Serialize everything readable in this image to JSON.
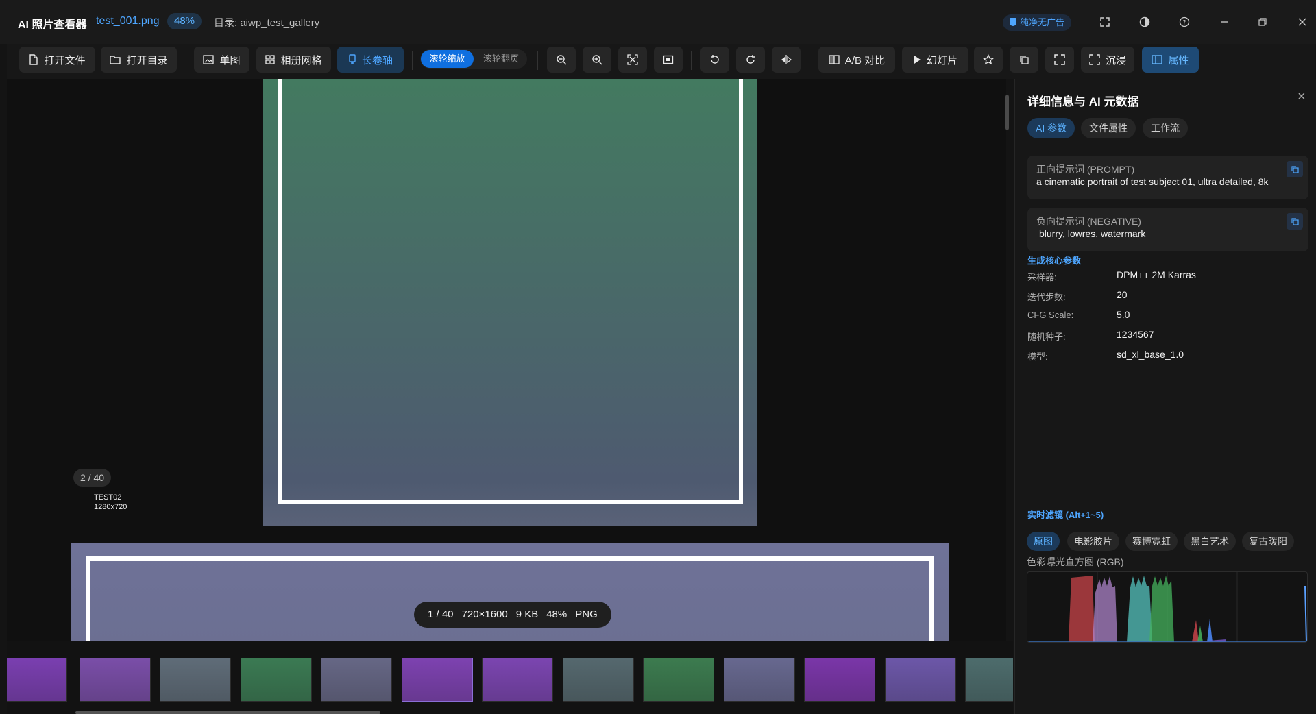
{
  "app": {
    "title": "AI 照片查看器",
    "file_name": "test_001.png",
    "zoom": "48%",
    "directory": "目录: aiwp_test_gallery",
    "no_ads": "纯净无广告",
    "accent_color": "#4ea6ff"
  },
  "toolbar": {
    "open_file": "打开文件",
    "open_dir": "打开目录",
    "single": "单图",
    "grid": "相册网格",
    "scroll": "长卷轴",
    "wheel_zoom": "滚轮缩放",
    "wheel_page": "滚轮翻页",
    "ab_compare": "A/B 对比",
    "slideshow": "幻灯片",
    "immersive": "沉浸",
    "properties": "属性"
  },
  "viewer": {
    "image2_badge": "2 / 40",
    "image2_label_line1": "TEST02",
    "image2_label_line2": "1280x720",
    "info": {
      "index": "1 / 40",
      "dimensions": "720×1600",
      "size": "9 KB",
      "zoom": "48%",
      "format": "PNG"
    }
  },
  "filmstrip": {
    "thumbnail_colors": [
      "#7a3fb0",
      "#7a4ea8",
      "#5f6c78",
      "#3b7a53",
      "#666785",
      "#7d42b0",
      "#7b45b0",
      "#55686e",
      "#3c7b4f",
      "#67688f",
      "#7a36a8",
      "#6c57a8",
      "#4d6c6c"
    ]
  },
  "panel": {
    "title": "详细信息与 AI 元数据",
    "tabs": [
      "AI 参数",
      "文件属性",
      "工作流"
    ],
    "prompt_label": "正向提示词 (PROMPT)",
    "prompt_value": "a cinematic portrait of test subject 01, ultra detailed, 8k",
    "negative_label": "负向提示词 (NEGATIVE)",
    "negative_value": "blurry, lowres, watermark",
    "core_params_title": "生成核心参数",
    "params": [
      {
        "key": "采样器:",
        "value": "DPM++ 2M Karras"
      },
      {
        "key": "迭代步数:",
        "value": "20"
      },
      {
        "key": "CFG Scale:",
        "value": "5.0"
      },
      {
        "key": "随机种子:",
        "value": "1234567"
      },
      {
        "key": "模型:",
        "value": "sd_xl_base_1.0"
      }
    ],
    "filters_title": "实时滤镜 (Alt+1~5)",
    "filters": [
      "原图",
      "电影胶片",
      "赛博霓虹",
      "黑白艺术",
      "复古暖阳"
    ],
    "histogram_label": "色彩曝光直方图 (RGB)"
  }
}
